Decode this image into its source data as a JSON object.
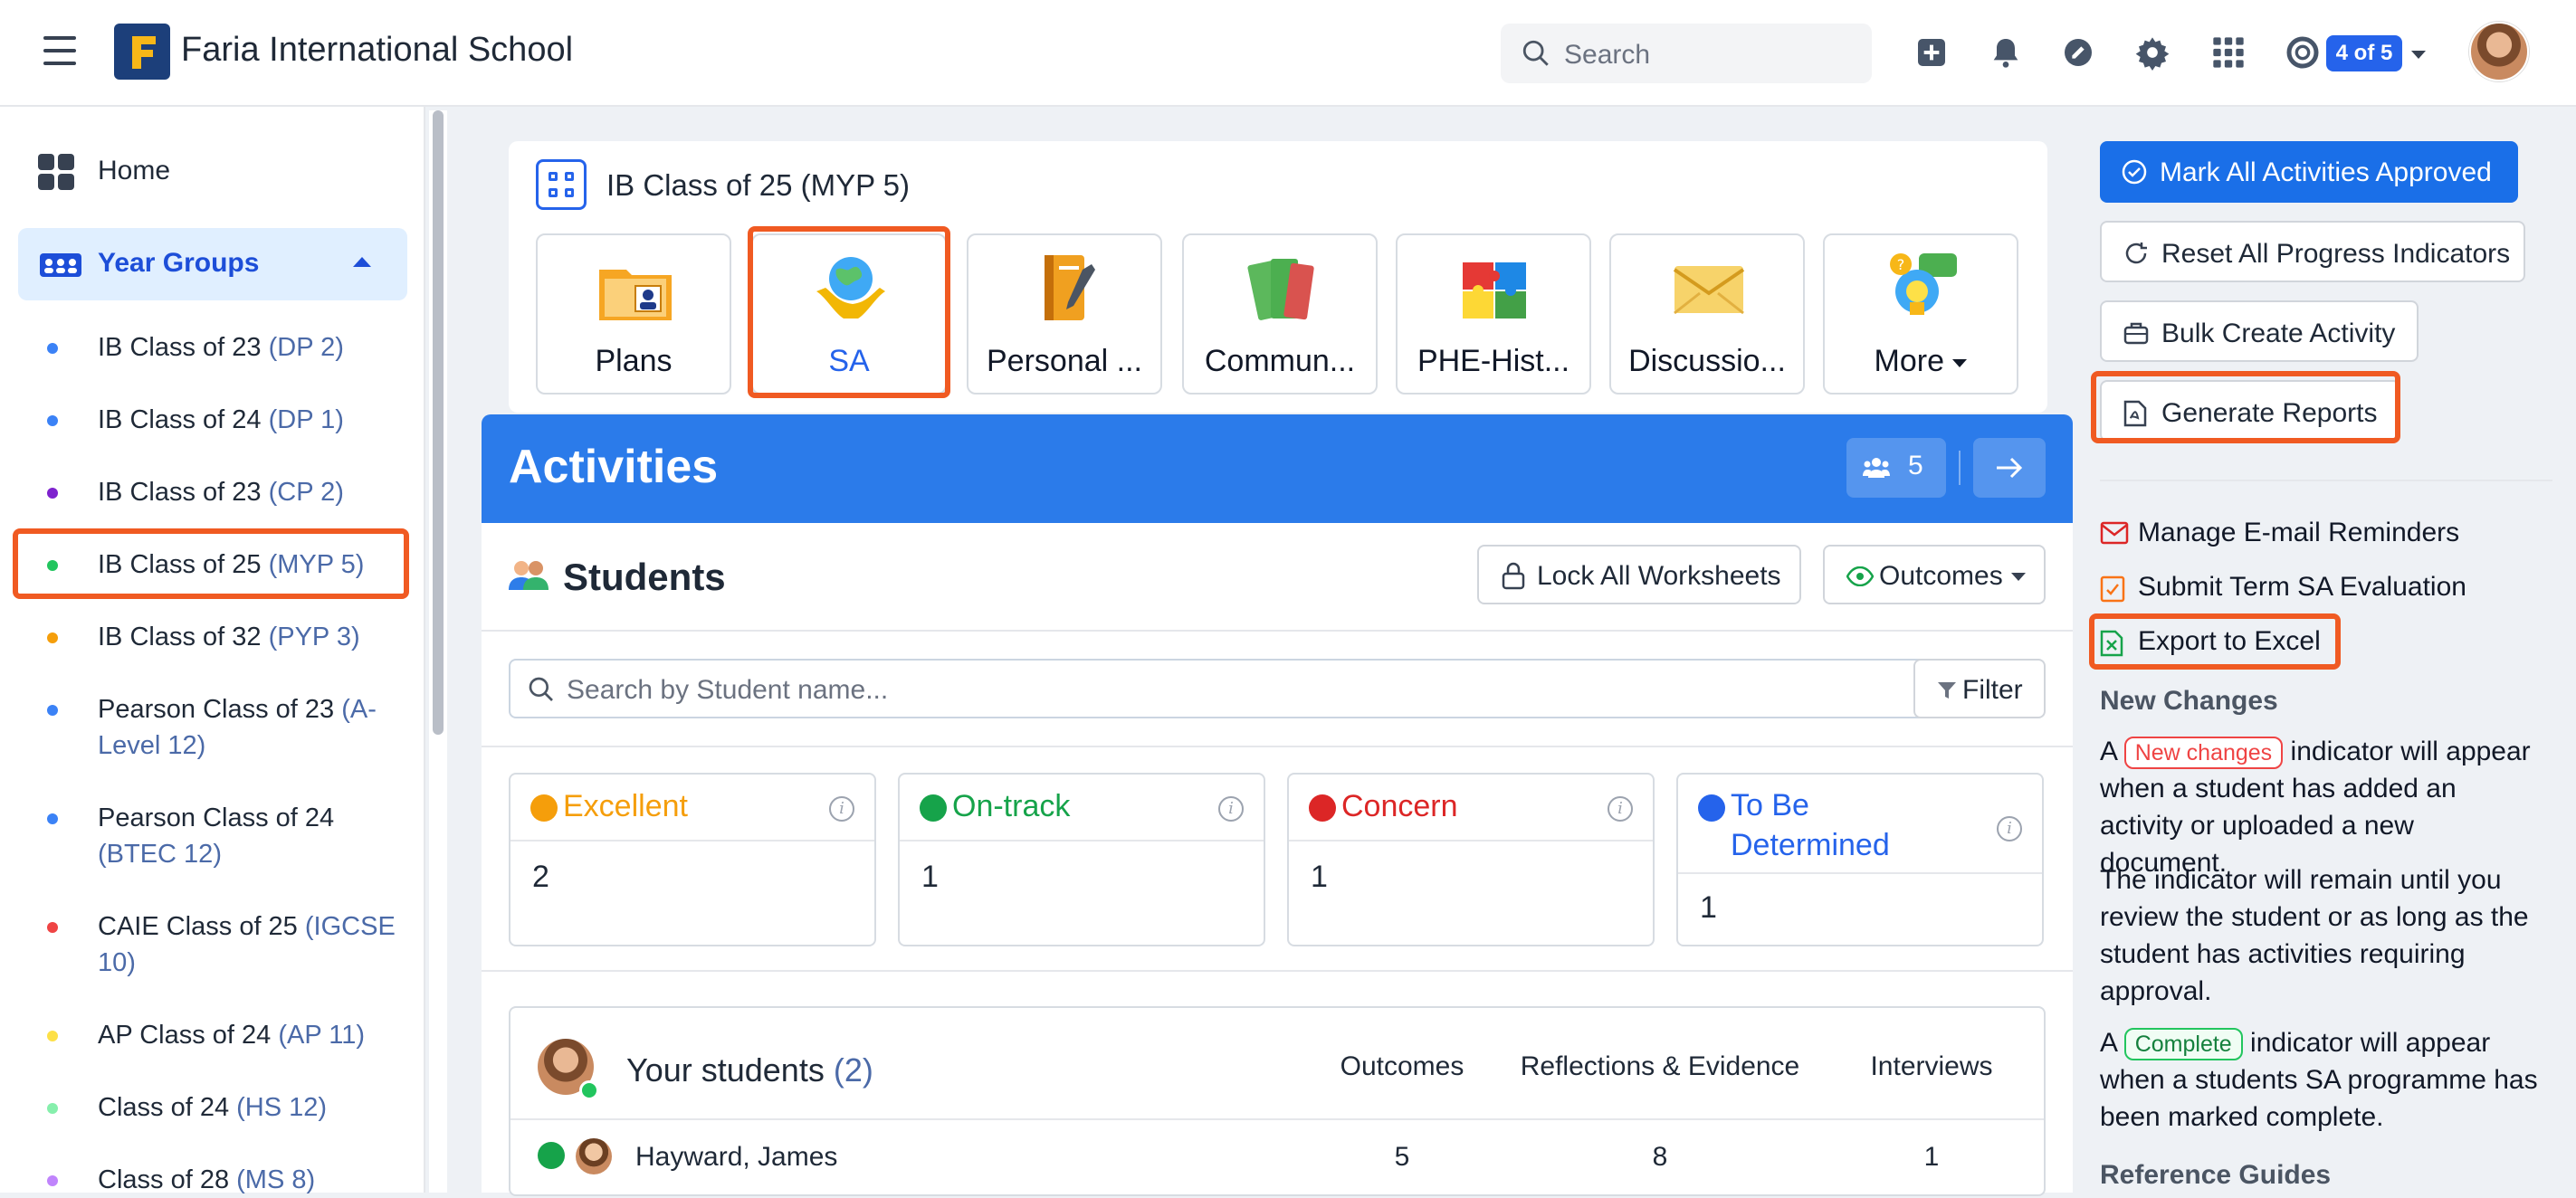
{
  "header": {
    "school_name": "Faria International School",
    "search_placeholder": "Search",
    "account_badge": "4 of 5"
  },
  "sidebar": {
    "home_label": "Home",
    "year_groups_label": "Year Groups",
    "items": [
      {
        "name": "IB Class of 23",
        "sub": "(DP 2)",
        "color": "#3b82f6"
      },
      {
        "name": "IB Class of 24",
        "sub": "(DP 1)",
        "color": "#3b82f6"
      },
      {
        "name": "IB Class of 23",
        "sub": "(CP 2)",
        "color": "#7e22ce"
      },
      {
        "name": "IB Class of 25",
        "sub": "(MYP 5)",
        "color": "#22c55e"
      },
      {
        "name": "IB Class of 32",
        "sub": "(PYP 3)",
        "color": "#f59e0b"
      },
      {
        "name": "Pearson Class of 23",
        "sub": "(A-Level 12)",
        "color": "#3b82f6"
      },
      {
        "name": "Pearson Class of 24",
        "sub": "(BTEC 12)",
        "color": "#3b82f6"
      },
      {
        "name": "CAIE Class of 25",
        "sub": "(IGCSE 10)",
        "color": "#ef4444"
      },
      {
        "name": "AP Class of 24",
        "sub": "(AP 11)",
        "color": "#fde047"
      },
      {
        "name": "Class of 24",
        "sub": "(HS 12)",
        "color": "#86efac"
      },
      {
        "name": "Class of 28",
        "sub": "(MS 8)",
        "color": "#c084fc"
      }
    ]
  },
  "class_card": {
    "title": "IB Class of 25 (MYP 5)",
    "tiles": [
      "Plans",
      "SA",
      "Personal ...",
      "Commun...",
      "PHE-Hist...",
      "Discussio...",
      "More"
    ]
  },
  "activities": {
    "title": "Activities",
    "member_count": "5",
    "students_title": "Students",
    "lock_label": "Lock All Worksheets",
    "outcomes_label": "Outcomes",
    "search_placeholder": "Search by Student name...",
    "filter_label": "Filter",
    "stats": [
      {
        "label": "Excellent",
        "value": "2",
        "color": "#f59e0b"
      },
      {
        "label": "On-track",
        "value": "1",
        "color": "#16a34a"
      },
      {
        "label": "Concern",
        "value": "1",
        "color": "#dc2626"
      },
      {
        "label": "To Be Determined",
        "value": "1",
        "color": "#2563eb"
      }
    ],
    "your_students": {
      "title": "Your students",
      "count": "(2)",
      "columns": [
        "Outcomes",
        "Reflections & Evidence",
        "Interviews"
      ],
      "rows": [
        {
          "name": "Hayward, James",
          "outcomes": "5",
          "reflections": "8",
          "interviews": "1"
        }
      ]
    }
  },
  "right_panel": {
    "mark_approved": "Mark All Activities Approved",
    "reset_progress": "Reset All Progress Indicators",
    "bulk_create": "Bulk Create Activity",
    "generate_reports": "Generate Reports",
    "manage_email": "Manage E-mail Reminders",
    "submit_term": "Submit Term SA Evaluation",
    "export_excel": "Export to Excel",
    "new_changes_heading": "New Changes",
    "p1_a": "A",
    "pill_new": "New changes",
    "p1_b": "indicator will appear when a student has added an activity or uploaded a new document.",
    "p2": "The indicator will remain until you review the student or as long as the student has activities requiring approval.",
    "p3_a": "A",
    "pill_complete": "Complete",
    "p3_b": "indicator will appear when a students SA programme has been marked complete.",
    "reference_heading": "Reference Guides"
  },
  "colors": {
    "accent": "#2b7bea",
    "highlight": "#f05a22"
  }
}
